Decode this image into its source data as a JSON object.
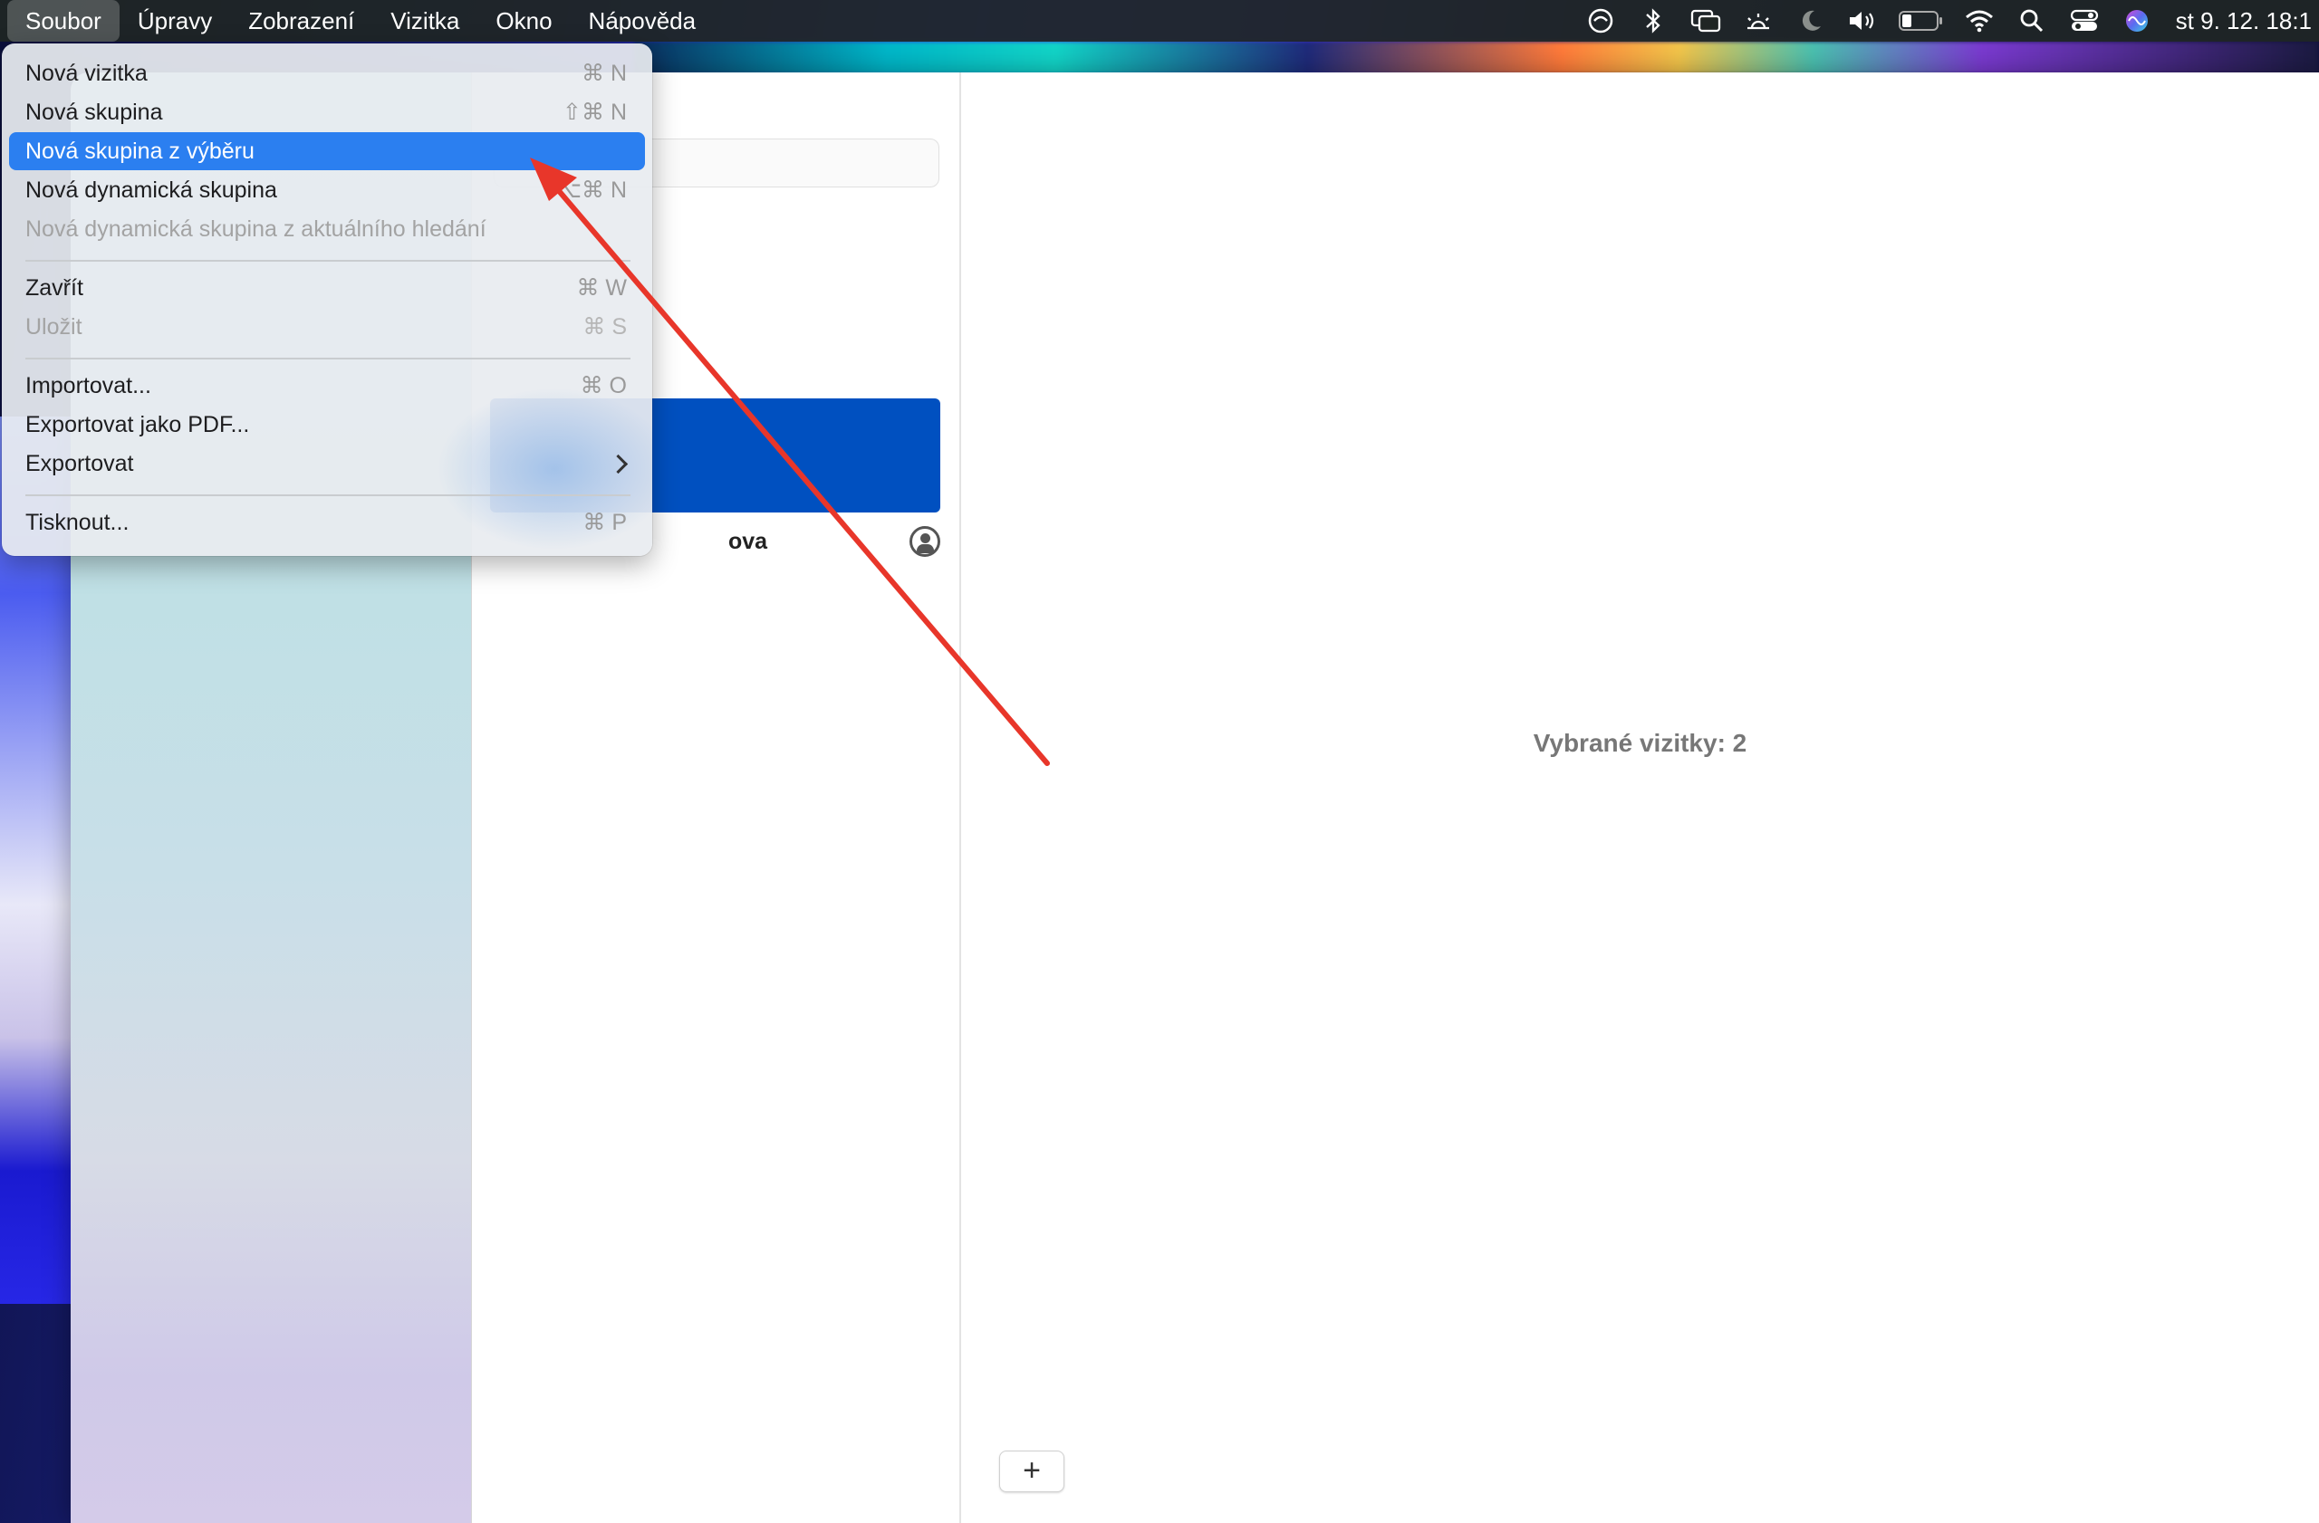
{
  "menubar": {
    "menus": [
      {
        "label": "Soubor"
      },
      {
        "label": "Úpravy"
      },
      {
        "label": "Zobrazení"
      },
      {
        "label": "Vizitka"
      },
      {
        "label": "Okno"
      },
      {
        "label": "Nápověda"
      }
    ],
    "status_icons": [
      "time-machine-icon",
      "bluetooth-icon",
      "screen-mirroring-icon",
      "display-brightness-icon",
      "focus-moon-icon",
      "volume-icon",
      "battery-icon",
      "wifi-icon",
      "spotlight-search-icon",
      "control-center-icon",
      "siri-icon"
    ],
    "clock": "st 9. 12.  18:1"
  },
  "file_menu": {
    "items": [
      {
        "label": "Nová vizitka",
        "shortcut": "⌘ N",
        "enabled": true
      },
      {
        "label": "Nová skupina",
        "shortcut": "⇧⌘ N",
        "enabled": true
      },
      {
        "label": "Nová skupina z výběru",
        "shortcut": "",
        "enabled": true,
        "highlighted": true
      },
      {
        "label": "Nová dynamická skupina",
        "shortcut": "⌥⌘ N",
        "enabled": true
      },
      {
        "label": "Nová dynamická skupina z aktuálního hledání",
        "shortcut": "",
        "enabled": false
      },
      {
        "label": "Zavřít",
        "shortcut": "⌘ W",
        "enabled": true
      },
      {
        "label": "Uložit",
        "shortcut": "⌘ S",
        "enabled": false
      },
      {
        "label": "Importovat...",
        "shortcut": "⌘ O",
        "enabled": true
      },
      {
        "label": "Exportovat jako PDF...",
        "shortcut": "",
        "enabled": true
      },
      {
        "label": "Exportovat",
        "shortcut": "",
        "enabled": true,
        "submenu": true
      },
      {
        "label": "Tisknout...",
        "shortcut": "⌘ P",
        "enabled": true
      }
    ]
  },
  "contacts": {
    "visible_row_fragment": "ova"
  },
  "detail": {
    "status": "Vybrané vizitky: 2",
    "add_button": "+"
  },
  "colors": {
    "menu_highlight": "#2b7ff0",
    "selected_row": "#0050c0",
    "annotation_arrow": "#e8362a"
  }
}
